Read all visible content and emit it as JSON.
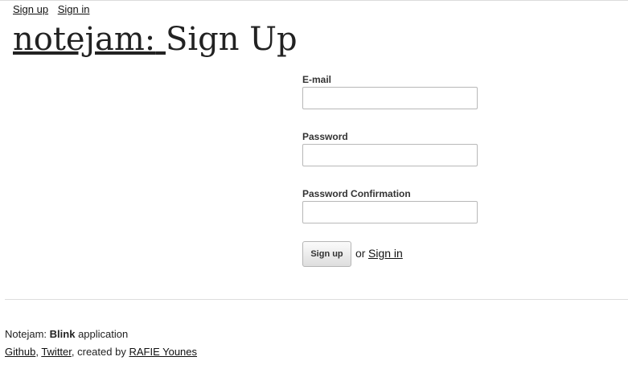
{
  "nav": {
    "sign_up": "Sign up",
    "sign_in": "Sign in"
  },
  "title": {
    "brand": "notejam:",
    "page": "Sign Up"
  },
  "form": {
    "email_label": "E-mail",
    "email_value": "",
    "password_label": "Password",
    "password_value": "",
    "confirm_label": "Password Confirmation",
    "confirm_value": "",
    "submit_label": "Sign up",
    "or_text": "or",
    "signin_link": "Sign in"
  },
  "footer": {
    "line1_prefix": "Notejam:",
    "line1_bold": "Blink",
    "line1_suffix": "application",
    "github": "Github",
    "twitter": "Twitter",
    "created_by": ", created by",
    "author": "RAFIE Younes"
  },
  "colors": {
    "text": "#222222",
    "link": "#111111",
    "divider": "#dddddd"
  }
}
